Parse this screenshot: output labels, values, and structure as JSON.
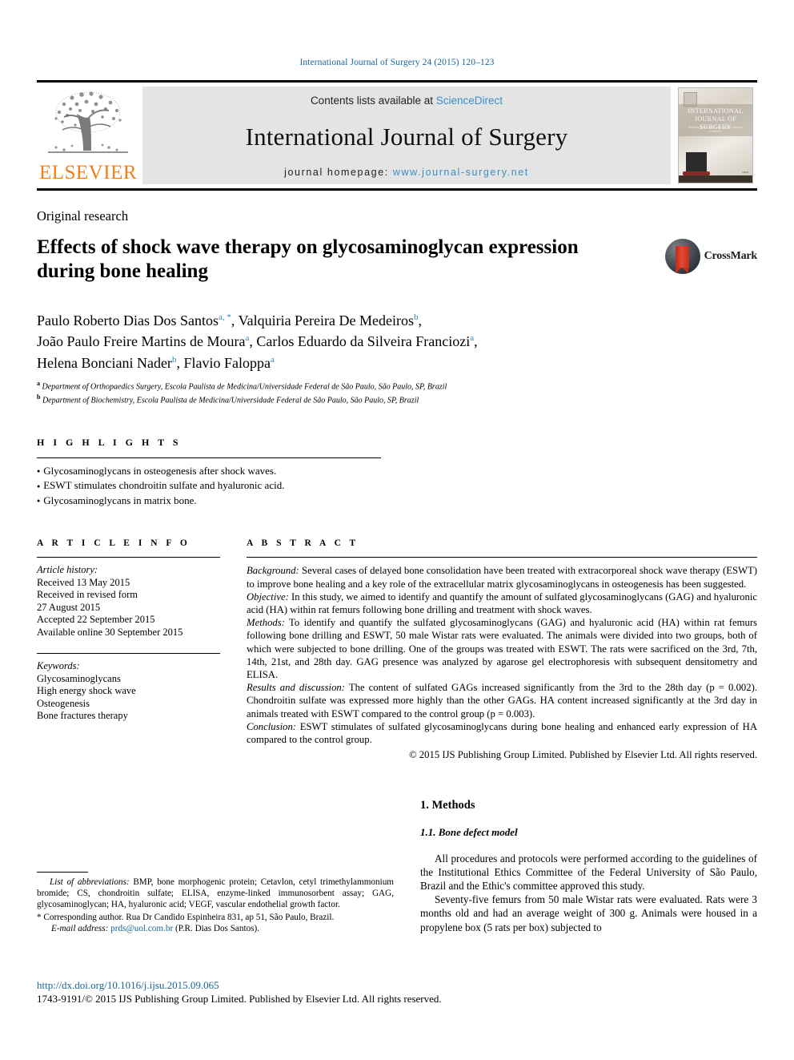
{
  "running_head": "International Journal of Surgery 24 (2015) 120–123",
  "masthead": {
    "contents_prefix": "Contents lists available at ",
    "sciencedirect": "ScienceDirect",
    "journal_name": "International Journal of Surgery",
    "homepage_label": "journal homepage:",
    "homepage_url": "www.journal-surgery.net",
    "publisher_word": "ELSEVIER",
    "cover_title_line1": "INTERNATIONAL",
    "cover_title_line2": "JOURNAL OF SURGERY",
    "cover_subtitle": "Including global surgery and surgical education worldwide"
  },
  "article": {
    "section_type": "Original research",
    "title": "Effects of shock wave therapy on glycosaminoglycan expression during bone healing",
    "crossmark_label": "CrossMark",
    "authors": [
      {
        "name": "Paulo Roberto Dias Dos Santos",
        "marks": "a, *",
        "sep": ", "
      },
      {
        "name": "Valquiria Pereira De Medeiros",
        "marks": "b",
        "sep": ",\n"
      },
      {
        "name": "João Paulo Freire Martins de Moura",
        "marks": "a",
        "sep": ", "
      },
      {
        "name": "Carlos Eduardo da Silveira Franciozi",
        "marks": "a",
        "sep": ",\n"
      },
      {
        "name": "Helena Bonciani Nader",
        "marks": "b",
        "sep": ", "
      },
      {
        "name": "Flavio Faloppa",
        "marks": "a",
        "sep": ""
      }
    ],
    "affiliations": [
      {
        "mark": "a",
        "text": "Department of Orthopaedics Surgery, Escola Paulista de Medicina/Universidade Federal de São Paulo, São Paulo, SP, Brazil"
      },
      {
        "mark": "b",
        "text": "Department of Biochemistry, Escola Paulista de Medicina/Universidade Federal de São Paulo, São Paulo, SP, Brazil"
      }
    ]
  },
  "highlights": {
    "heading": "H I G H L I G H T S",
    "items": [
      "Glycosaminoglycans in osteogenesis after shock waves.",
      "ESWT stimulates chondroitin sulfate and hyaluronic acid.",
      "Glycosaminoglycans in matrix bone."
    ]
  },
  "article_info": {
    "heading": "A R T I C L E   I N F O",
    "history_label": "Article history:",
    "history": [
      "Received 13 May 2015",
      "Received in revised form",
      "27 August 2015",
      "Accepted 22 September 2015",
      "Available online 30 September 2015"
    ],
    "keywords_label": "Keywords:",
    "keywords": [
      "Glycosaminoglycans",
      "High energy shock wave",
      "Osteogenesis",
      "Bone fractures therapy"
    ]
  },
  "abstract": {
    "heading": "A B S T R A C T",
    "sections": [
      {
        "label": "Background:",
        "text": " Several cases of delayed bone consolidation have been treated with extracorporeal shock wave therapy (ESWT) to improve bone healing and a key role of the extracellular matrix glycosaminoglycans in osteogenesis has been suggested."
      },
      {
        "label": "Objective:",
        "text": " In this study, we aimed to identify and quantify the amount of sulfated glycosaminoglycans (GAG) and hyaluronic acid (HA) within rat femurs following bone drilling and treatment with shock waves."
      },
      {
        "label": "Methods:",
        "text": " To identify and quantify the sulfated glycosaminoglycans (GAG) and hyaluronic acid (HA) within rat femurs following bone drilling and ESWT, 50 male Wistar rats were evaluated. The animals were divided into two groups, both of which were subjected to bone drilling. One of the groups was treated with ESWT. The rats were sacrificed on the 3rd, 7th, 14th, 21st, and 28th day. GAG presence was analyzed by agarose gel electrophoresis with subsequent densitometry and ELISA."
      },
      {
        "label": "Results and discussion:",
        "text": " The content of sulfated GAGs increased significantly from the 3rd to the 28th day (p = 0.002). Chondroitin sulfate was expressed more highly than the other GAGs. HA content increased significantly at the 3rd day in animals treated with ESWT compared to the control group (p = 0.003)."
      },
      {
        "label": "Conclusion:",
        "text": " ESWT stimulates of sulfated glycosaminoglycans during bone healing and enhanced early expression of HA compared to the control group."
      }
    ],
    "copyright": "© 2015 IJS Publishing Group Limited. Published by Elsevier Ltd. All rights reserved."
  },
  "body": {
    "heading_1": "1. Methods",
    "heading_1_1": "1.1. Bone defect model",
    "paragraphs": [
      "All procedures and protocols were performed according to the guidelines of the Institutional Ethics Committee of the Federal University of São Paulo, Brazil and the Ethic's committee approved this study.",
      "Seventy-five femurs from 50 male Wistar rats were evaluated. Rats were 3 months old and had an average weight of 300 g. Animals were housed in a propylene box (5 rats per box) subjected to"
    ]
  },
  "footnotes": {
    "abbrev_label": "List of abbreviations:",
    "abbrev_text": " BMP, bone morphogenic protein; Cetavlon, cetyl trimethylammonium bromide; CS, chondroitin sulfate; ELISA, enzyme-linked immunosorbent assay; GAG, glycosaminoglycan; HA, hyaluronic acid; VEGF, vascular endothelial growth factor.",
    "corresponding_marker": "*",
    "corresponding_text": " Corresponding author. Rua Dr Candido Espinheira 831, ap 51, São Paulo, Brazil.",
    "email_label": "E-mail address:",
    "email": "prds@uol.com.br",
    "email_suffix": " (P.R. Dias Dos Santos)."
  },
  "bottom": {
    "doi": "http://dx.doi.org/10.1016/j.ijsu.2015.09.065",
    "issn_line": "1743-9191/© 2015 IJS Publishing Group Limited. Published by Elsevier Ltd. All rights reserved."
  },
  "colors": {
    "link_blue": "#1a6496",
    "accent_blue": "#3a8fc4",
    "elsevier_orange": "#F07F1A",
    "band_gray": "#e4e4e4"
  }
}
